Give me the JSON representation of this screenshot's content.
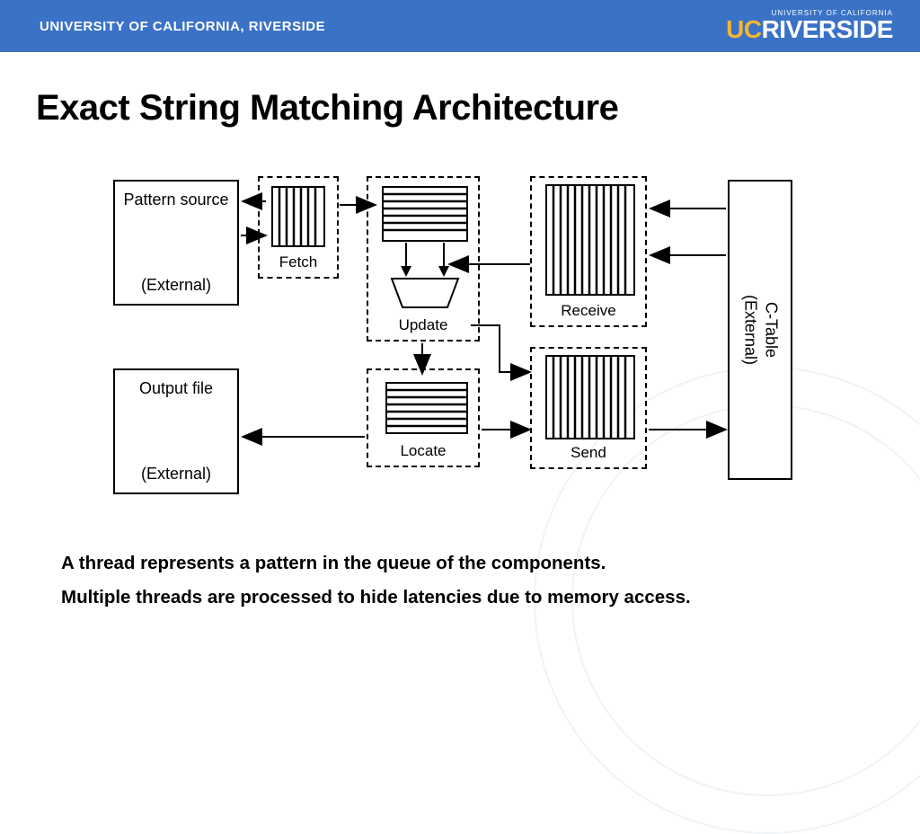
{
  "header": {
    "left": "UNIVERSITY OF CALIFORNIA, RIVERSIDE",
    "logo_small": "UNIVERSITY OF CALIFORNIA",
    "logo_uc": "UC",
    "logo_riverside": "RIVERSIDE"
  },
  "title": "Exact String Matching Architecture",
  "nodes": {
    "pattern_source": {
      "line1": "Pattern source",
      "line2": "(External)"
    },
    "output_file": {
      "line1": "Output file",
      "line2": "(External)"
    },
    "fetch": "Fetch",
    "update": "Update",
    "locate": "Locate",
    "receive": "Receive",
    "send": "Send",
    "ctable": {
      "line1": "C-Table",
      "line2": "(External)"
    }
  },
  "description": {
    "line1": "A thread represents a pattern in the queue of the components.",
    "line2": "Multiple threads are processed to hide latencies due to memory access."
  }
}
